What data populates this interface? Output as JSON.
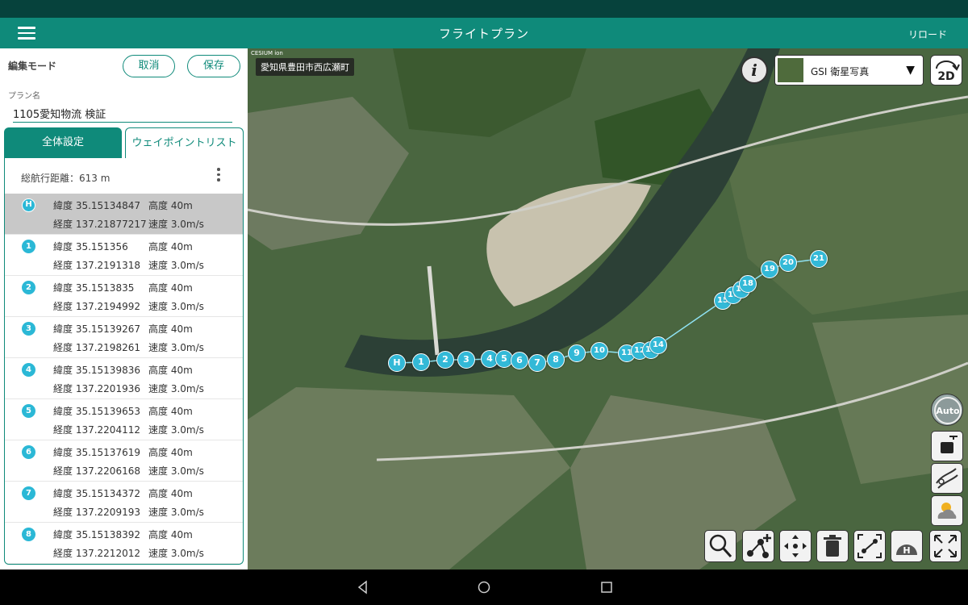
{
  "appbar": {
    "title": "フライトプラン",
    "reload_label": "リロード"
  },
  "editor": {
    "mode_label": "編集モード",
    "cancel_label": "取消",
    "save_label": "保存",
    "plan_name_label": "プラン名",
    "plan_name_value": "1105愛知物流 検証"
  },
  "tabs": {
    "general": "全体設定",
    "waypoints": "ウェイポイントリスト"
  },
  "list": {
    "total_distance": "総航行距離：613 m",
    "rows": [
      {
        "badge": "H",
        "lat": "緯度 35.15134847",
        "lon": "経度 137.21877217",
        "alt": "高度 40m",
        "spd": "速度 3.0m/s"
      },
      {
        "badge": "1",
        "lat": "緯度 35.151356",
        "lon": "経度 137.2191318",
        "alt": "高度 40m",
        "spd": "速度 3.0m/s"
      },
      {
        "badge": "2",
        "lat": "緯度 35.1513835",
        "lon": "経度 137.2194992",
        "alt": "高度 40m",
        "spd": "速度 3.0m/s"
      },
      {
        "badge": "3",
        "lat": "緯度 35.15139267",
        "lon": "経度 137.2198261",
        "alt": "高度 40m",
        "spd": "速度 3.0m/s"
      },
      {
        "badge": "4",
        "lat": "緯度 35.15139836",
        "lon": "経度 137.2201936",
        "alt": "高度 40m",
        "spd": "速度 3.0m/s"
      },
      {
        "badge": "5",
        "lat": "緯度 35.15139653",
        "lon": "経度 137.2204112",
        "alt": "高度 40m",
        "spd": "速度 3.0m/s"
      },
      {
        "badge": "6",
        "lat": "緯度 35.15137619",
        "lon": "経度 137.2206168",
        "alt": "高度 40m",
        "spd": "速度 3.0m/s"
      },
      {
        "badge": "7",
        "lat": "緯度 35.15134372",
        "lon": "経度 137.2209193",
        "alt": "高度 40m",
        "spd": "速度 3.0m/s"
      },
      {
        "badge": "8",
        "lat": "緯度 35.15138392",
        "lon": "経度 137.2212012",
        "alt": "高度 40m",
        "spd": "速度 3.0m/s"
      }
    ]
  },
  "map": {
    "attribution": "CESIUM ion",
    "location": "愛知県豊田市西広瀬町",
    "layer_name": "GSI 衛星写真",
    "mode_2d": "2D",
    "auto_label": "Auto",
    "waypoints": [
      "H",
      "1",
      "2",
      "3",
      "4",
      "5",
      "6",
      "7",
      "8",
      "9",
      "10",
      "11",
      "12",
      "13",
      "14",
      "15",
      "16",
      "17",
      "18",
      "19",
      "20",
      "21"
    ]
  },
  "colors": {
    "primary": "#0f8a7a",
    "waypoint": "#33b9d7",
    "status_bar": "#06423c"
  }
}
